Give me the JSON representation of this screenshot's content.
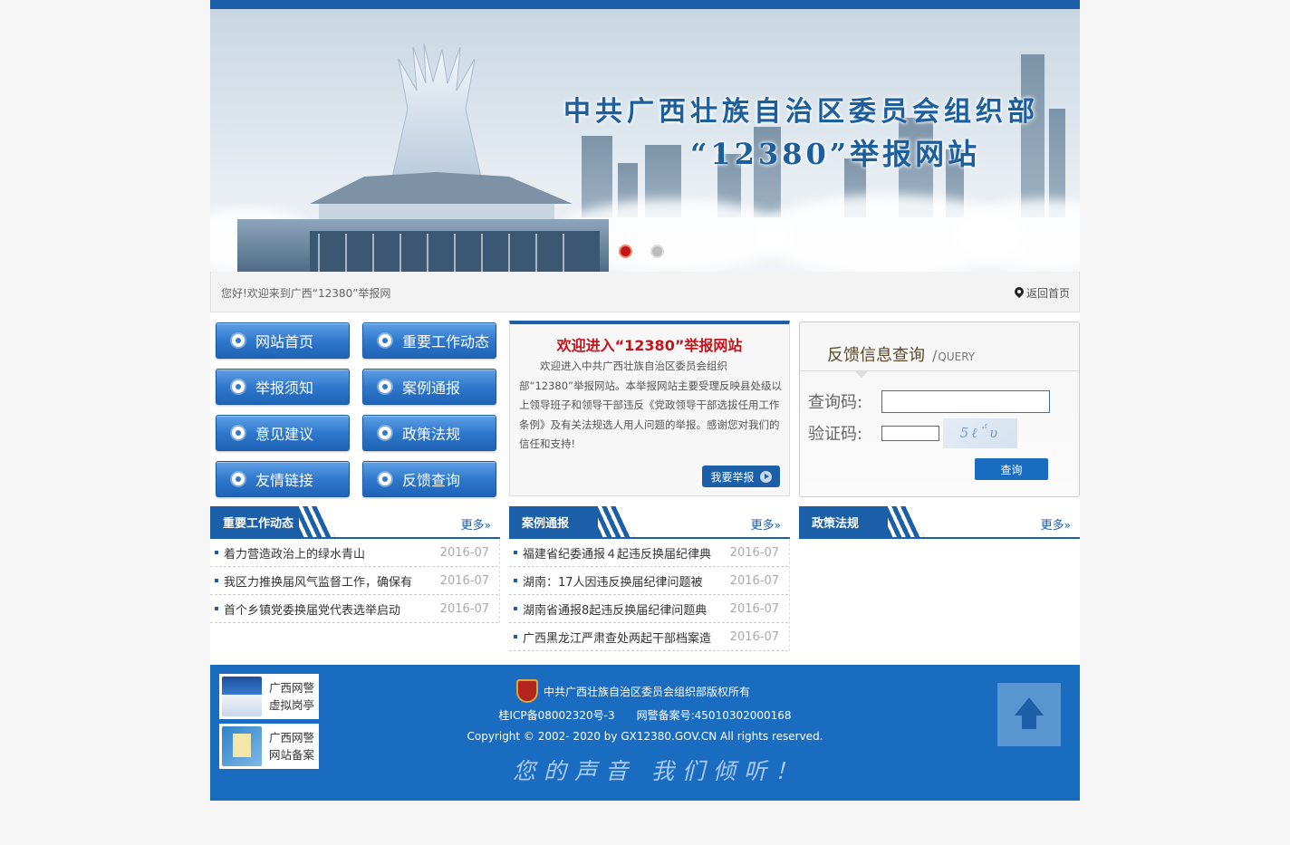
{
  "banner": {
    "title_line1": "中共广西壮族自治区委员会组织部",
    "title_line2": "“12380”举报网站"
  },
  "welcome_bar": {
    "greeting": "您好!欢迎来到广西“12380”举报网",
    "home_link": "返回首页"
  },
  "nav": {
    "items": [
      {
        "label": "网站首页"
      },
      {
        "label": "重要工作动态"
      },
      {
        "label": "举报须知"
      },
      {
        "label": "案例通报"
      },
      {
        "label": "意见建议"
      },
      {
        "label": "政策法规"
      },
      {
        "label": "友情链接"
      },
      {
        "label": "反馈查询"
      }
    ]
  },
  "intro": {
    "title": "欢迎进入“12380”举报网站",
    "body": "欢迎进入中共广西壮族自治区委员会组织部“12380”举报网站。本举报网站主要受理反映县处级以上领导班子和领导干部违反《党政领导干部选拔任用工作条例》及有关法规选人用人问题的举报。感谢您对我们的信任和支持!",
    "button": "我要举报"
  },
  "query": {
    "title": "反馈信息查询",
    "subtitle": "QUERY",
    "code_label": "查询码:",
    "captcha_label": "验证码:",
    "captcha_text": "5ℓ΅υ",
    "button": "查询"
  },
  "columns": [
    {
      "title": "重要工作动态",
      "more": "更多",
      "items": [
        {
          "title": "着力营造政治上的绿水青山",
          "date": "2016-07"
        },
        {
          "title": "我区力推换届风气监督工作，确保有",
          "date": "2016-07"
        },
        {
          "title": "首个乡镇党委换届党代表选举启动",
          "date": "2016-07"
        }
      ]
    },
    {
      "title": "案例通报",
      "more": "更多",
      "items": [
        {
          "title": "福建省纪委通报４起违反换届纪律典",
          "date": "2016-07"
        },
        {
          "title": "湖南：17人因违反换届纪律问题被",
          "date": "2016-07"
        },
        {
          "title": "湖南省通报8起违反换届纪律问题典",
          "date": "2016-07"
        },
        {
          "title": "广西黑龙江严肃查处两起干部档案造",
          "date": "2016-07"
        }
      ]
    },
    {
      "title": "政策法规",
      "more": "更多",
      "items": []
    }
  ],
  "footer": {
    "badge1_line1": "广西网警",
    "badge1_line2": "虚拟岗亭",
    "badge2_line1": "广西网警",
    "badge2_line2": "网站备案",
    "copyright_owner": "中共广西壮族自治区委员会组织部版权所有",
    "icp": "桂ICP备08002320号-3　　网警备案号:45010302000168",
    "copyright": "Copyright © 2002- 2020 by GX12380.GOV.CN All rights reserved.",
    "slogan": "您的声音 我们倾听！"
  }
}
